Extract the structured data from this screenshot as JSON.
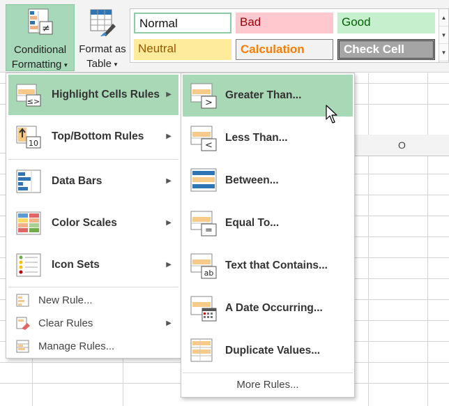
{
  "ribbon": {
    "conditional_formatting": {
      "line1": "Conditional",
      "line2": "Formatting",
      "icon": "conditional-formatting-icon"
    },
    "format_as_table": {
      "line1": "Format as",
      "line2": "Table",
      "icon": "format-as-table-icon"
    },
    "cell_styles": {
      "normal": "Normal",
      "bad": "Bad",
      "good": "Good",
      "neutral": "Neutral",
      "calculation": "Calculation",
      "check_cell": "Check Cell"
    }
  },
  "sheet": {
    "column_header": "O"
  },
  "menu": {
    "items": [
      {
        "label": "Highlight Cells Rules",
        "mnemonic": "H",
        "icon": "highlight-cells-rules-icon",
        "has_submenu": true,
        "highlighted": true
      },
      {
        "label": "Top/Bottom Rules",
        "mnemonic": "T",
        "icon": "top-bottom-rules-icon",
        "has_submenu": true
      },
      {
        "label": "Data Bars",
        "mnemonic": "D",
        "icon": "data-bars-icon",
        "has_submenu": true
      },
      {
        "label": "Color Scales",
        "mnemonic": "S",
        "icon": "color-scales-icon",
        "has_submenu": true
      },
      {
        "label": "Icon Sets",
        "mnemonic": "I",
        "icon": "icon-sets-icon",
        "has_submenu": true
      }
    ],
    "small_items": [
      {
        "label": "New Rule...",
        "icon": "new-rule-icon"
      },
      {
        "label": "Clear Rules",
        "icon": "clear-rules-icon",
        "has_submenu": true
      },
      {
        "label": "Manage Rules...",
        "icon": "manage-rules-icon"
      }
    ]
  },
  "submenu": {
    "items": [
      {
        "label": "Greater Than...",
        "icon": "greater-than-icon",
        "highlighted": true
      },
      {
        "label": "Less Than...",
        "icon": "less-than-icon"
      },
      {
        "label": "Between...",
        "icon": "between-icon"
      },
      {
        "label": "Equal To...",
        "icon": "equal-to-icon"
      },
      {
        "label": "Text that Contains...",
        "icon": "text-contains-icon"
      },
      {
        "label": "A Date Occurring...",
        "icon": "date-occurring-icon"
      },
      {
        "label": "Duplicate Values...",
        "icon": "duplicate-values-icon"
      }
    ],
    "more_rules": "More Rules..."
  },
  "colors": {
    "highlight": "#a9d8b7",
    "accent_orange": "#f5b26b",
    "accent_blue": "#2e75b6",
    "bad_fill": "#ffc7ce",
    "good_fill": "#c6efce",
    "neutral_fill": "#ffeb9c"
  }
}
